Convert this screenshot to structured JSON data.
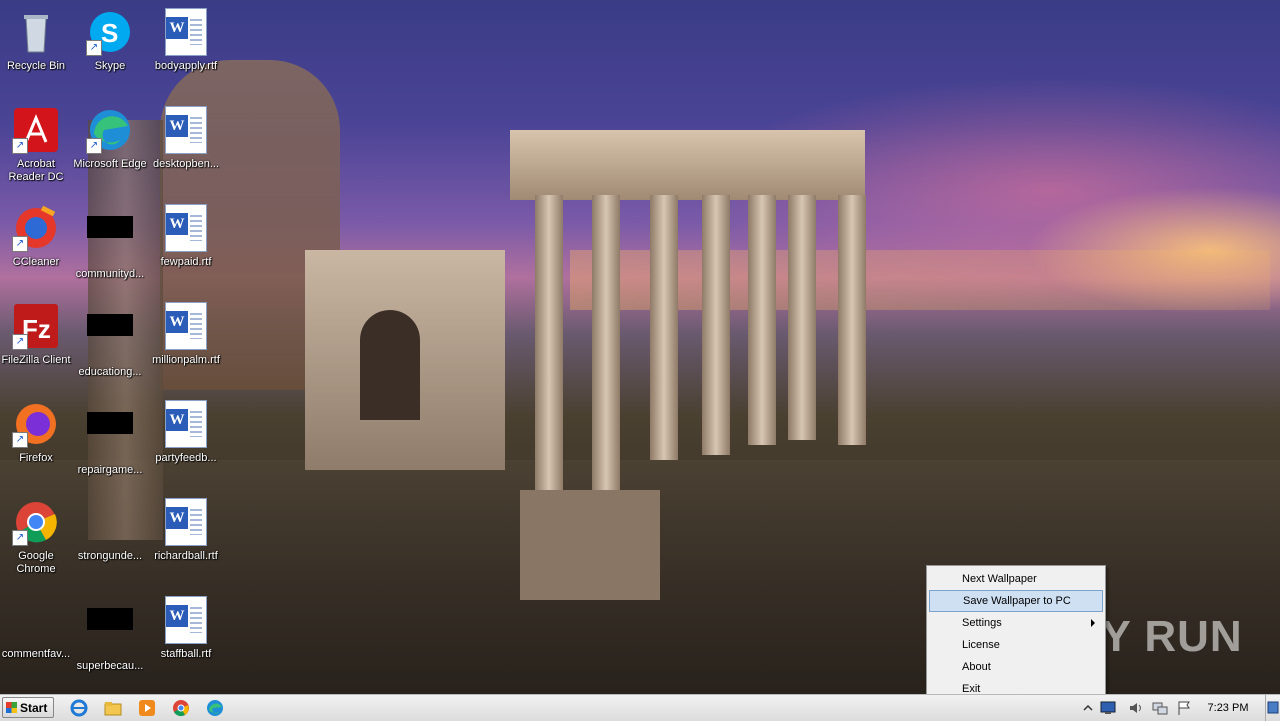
{
  "desktop_icons": [
    {
      "label": "Recycle Bin",
      "icon": "recycle-bin-icon"
    },
    {
      "label": "Skype",
      "icon": "skype-icon"
    },
    {
      "label": "bodyapply.rtf",
      "icon": "word-doc-icon"
    },
    {
      "label": "Acrobat Reader DC",
      "icon": "acrobat-icon"
    },
    {
      "label": "Microsoft Edge",
      "icon": "edge-icon"
    },
    {
      "label": "desktopben...",
      "icon": "word-doc-icon"
    },
    {
      "label": "CCleaner",
      "icon": "ccleaner-icon"
    },
    {
      "label": "communityd...",
      "icon": "blank-file-icon"
    },
    {
      "label": "fewpaid.rtf",
      "icon": "word-doc-icon"
    },
    {
      "label": "FileZilla Client",
      "icon": "filezilla-icon"
    },
    {
      "label": "educationg...",
      "icon": "blank-file-icon"
    },
    {
      "label": "millionpalm.rtf",
      "icon": "word-doc-icon"
    },
    {
      "label": "Firefox",
      "icon": "firefox-icon"
    },
    {
      "label": "repairgame...",
      "icon": "blank-file-icon"
    },
    {
      "label": "partyfeedb...",
      "icon": "word-doc-icon"
    },
    {
      "label": "Google Chrome",
      "icon": "chrome-icon"
    },
    {
      "label": "strongunde...",
      "icon": "blank-file-icon"
    },
    {
      "label": "richardball.rtf",
      "icon": "word-doc-icon"
    },
    {
      "label": "commentfav...",
      "icon": "blank-file-icon"
    },
    {
      "label": "superbecau...",
      "icon": "blank-file-icon"
    },
    {
      "label": "staffball.rtf",
      "icon": "word-doc-icon"
    }
  ],
  "context_menu": {
    "items": [
      {
        "label": "Next Wallpaper"
      },
      {
        "label": "Save Wallpaper to PC",
        "highlighted": true
      },
      {
        "label": "Settings",
        "submenu": true
      },
      {
        "label": "License"
      },
      {
        "label": "About"
      },
      {
        "label": "Exit"
      }
    ]
  },
  "watermark": "ANY RUN",
  "taskbar": {
    "start_label": "Start",
    "pinned": [
      "internet-explorer-icon",
      "file-explorer-icon",
      "media-player-icon",
      "chrome-icon",
      "edge-icon"
    ],
    "clock": "7:23 PM"
  }
}
